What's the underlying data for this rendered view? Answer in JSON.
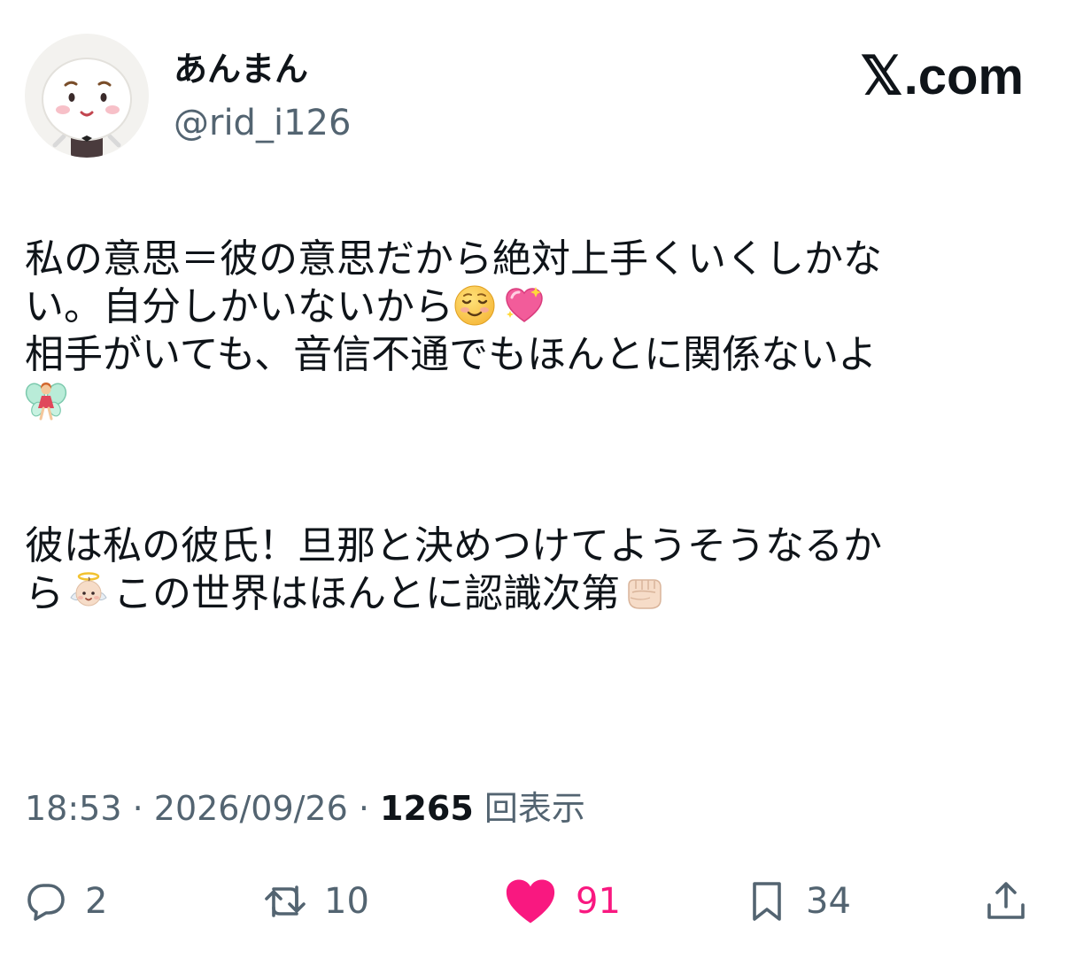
{
  "user": {
    "display_name": "あんまん",
    "handle": "@rid_i126"
  },
  "brand": {
    "x_glyph": "𝕏",
    "suffix": ".com"
  },
  "post": {
    "line1": "私の意思＝彼の意思だから絶対上手くいくしかな",
    "line2_text": "い。自分しかいないから",
    "line3": "相手がいても、音信不通でもほんとに関係ないよ",
    "line5": "彼は私の彼氏！旦那と決めつけてようそうなるか",
    "line6_a": "ら",
    "line6_b": "この世界はほんとに認識次第"
  },
  "meta": {
    "time": "18:53",
    "separator": " · ",
    "date": "2026/09/26",
    "views_count": "1265",
    "views_label": " 回表示"
  },
  "actions": {
    "reply_count": "2",
    "retweet_count": "10",
    "like_count": "91",
    "bookmark_count": "34"
  },
  "colors": {
    "text_primary": "#0f1419",
    "text_secondary": "#536471",
    "like": "#f91880"
  },
  "icons": {
    "reply": "reply-icon",
    "retweet": "retweet-icon",
    "like": "heart-icon",
    "bookmark": "bookmark-icon",
    "share": "share-icon"
  }
}
